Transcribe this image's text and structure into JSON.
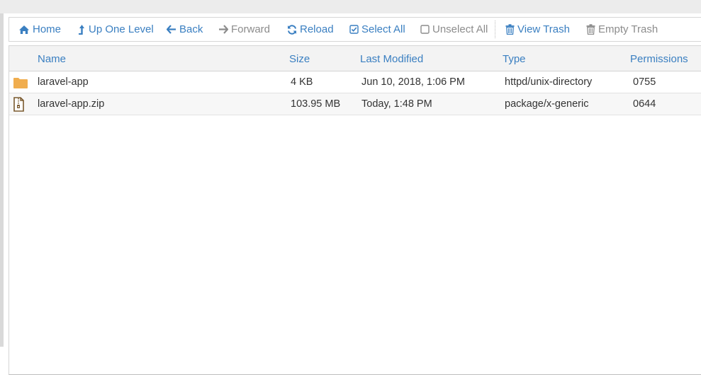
{
  "toolbar": {
    "home": "Home",
    "up_one_level": "Up One Level",
    "back": "Back",
    "forward": "Forward",
    "reload": "Reload",
    "select_all": "Select All",
    "unselect_all": "Unselect All",
    "view_trash": "View Trash",
    "empty_trash": "Empty Trash"
  },
  "columns": {
    "name": "Name",
    "size": "Size",
    "last_modified": "Last Modified",
    "type": "Type",
    "permissions": "Permissions"
  },
  "files": [
    {
      "icon": "folder-icon",
      "name": "laravel-app",
      "size": "4 KB",
      "modified": "Jun 10, 2018, 1:06 PM",
      "type": "httpd/unix-directory",
      "permissions": "0755"
    },
    {
      "icon": "zip-file-icon",
      "name": "laravel-app.zip",
      "size": "103.95 MB",
      "modified": "Today, 1:48 PM",
      "type": "package/x-generic",
      "permissions": "0644"
    }
  ],
  "colors": {
    "accent": "#3a7fc1",
    "disabled": "#8c8c8c",
    "folder": "#f0ad4e",
    "zip": "#7a5a2f"
  }
}
